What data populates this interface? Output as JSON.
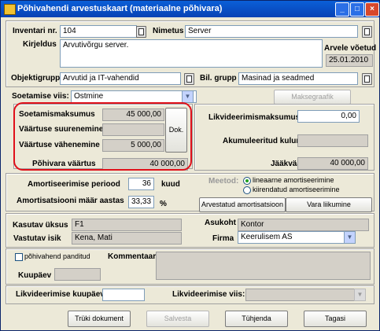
{
  "window": {
    "title": "Põhivahendi arvestuskaart (materiaalne põhivara)"
  },
  "header": {
    "inventory_no_label": "Inventari nr.",
    "inventory_no": "104",
    "name_label": "Nimetus",
    "name": "Server",
    "description_label": "Kirjeldus",
    "description": "Arvutivõrgu server.",
    "registered_label": "Arvele võetud",
    "registered_date": "25.01.2010",
    "object_group_label": "Objektigrupp",
    "object_group": "Arvutid ja IT-vahendid",
    "balance_group_label": "Bil. grupp",
    "balance_group": "Masinad ja seadmed"
  },
  "acquisition": {
    "method_label": "Soetamise viis:",
    "method": "Ostmine",
    "payment_schedule_button": "Maksegraafik",
    "cost_label": "Soetamismaksumus",
    "cost": "45 000,00",
    "increase_label": "Väärtuse suurenemine",
    "increase": "",
    "decrease_label": "Väärtuse vähenemine",
    "decrease": "5 000,00",
    "doc_button": "Dok.",
    "asset_value_label": "Põhivara väärtus",
    "asset_value": "40 000,00"
  },
  "liquidation_value": {
    "value_label": "Likvideerimismaksumus",
    "value": "0,00",
    "accumulated_label": "Akumuleeritud kulum",
    "accumulated": "",
    "residual_label": "Jääkväärtus",
    "residual": "40 000,00"
  },
  "depreciation": {
    "period_label": "Amortiseerimise periood",
    "period": "36",
    "period_unit": "kuud",
    "rate_label": "Amortisatsiooni määr aastas",
    "rate": "33,33",
    "rate_unit": "%",
    "method_label": "Meetod:",
    "method_linear": "lineaarne amortiseerimine",
    "method_declining": "kiirendatud amortiseerimine",
    "calc_button": "Arvestatud amortisatsioon",
    "movements_button": "Vara liikumine"
  },
  "location": {
    "unit_label": "Kasutav üksus",
    "unit": "F1",
    "location_label": "Asukoht",
    "location": "Kontor",
    "responsible_label": "Vastutav isik",
    "responsible": "Kena, Mati",
    "company_label": "Firma",
    "company": "Keerulisem AS"
  },
  "notes": {
    "pledged_label": "põhivahend panditud",
    "comment_label": "Kommentaar",
    "pledge_date_label": "Kuupäev",
    "comment": ""
  },
  "liquidation": {
    "date_label": "Likvideerimise kuupäev",
    "date": "",
    "method_label": "Likvideerimise viis:",
    "method": ""
  },
  "footer": {
    "print_button": "Trüki dokument",
    "save_button": "Salvesta",
    "clear_button": "Tühjenda",
    "back_button": "Tagasi"
  }
}
